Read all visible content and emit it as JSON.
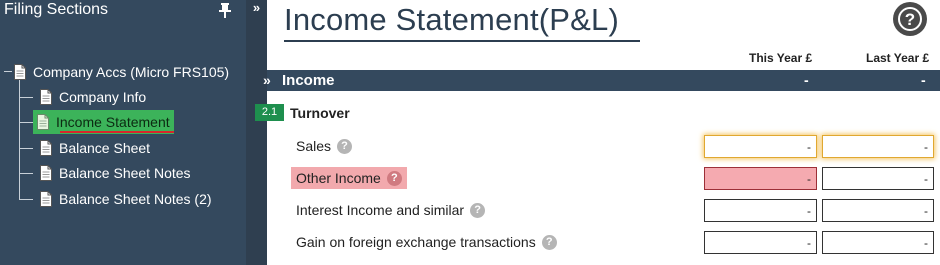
{
  "sidebar": {
    "title": "Filing Sections",
    "root": {
      "label": "Company Accs (Micro FRS105)",
      "icon": "document-icon"
    },
    "items": [
      {
        "label": "Company Info",
        "icon": "document-icon",
        "active": false
      },
      {
        "label": "Income Statement",
        "icon": "document-icon",
        "active": true
      },
      {
        "label": "Balance Sheet",
        "icon": "document-icon",
        "active": false
      },
      {
        "label": "Balance Sheet Notes",
        "icon": "document-icon",
        "active": false
      },
      {
        "label": "Balance Sheet Notes (2)",
        "icon": "document-icon",
        "active": false
      }
    ],
    "collapse_label": "»"
  },
  "page": {
    "title": "Income Statement(P&L)",
    "help_label": "?"
  },
  "columns": {
    "this_year": "This Year £",
    "last_year": "Last Year £"
  },
  "section": {
    "title": "Income",
    "this_year_total": "-",
    "last_year_total": "-"
  },
  "group": {
    "ref": "2.1",
    "label": "Turnover"
  },
  "rows": [
    {
      "label": "Sales",
      "this_year": "-",
      "last_year": "-",
      "state": "focused"
    },
    {
      "label": "Other Income",
      "this_year": "-",
      "last_year": "-",
      "state": "error"
    },
    {
      "label": "Interest Income and similar",
      "this_year": "-",
      "last_year": "-",
      "state": "normal"
    },
    {
      "label": "Gain on foreign exchange transactions",
      "this_year": "-",
      "last_year": "-",
      "state": "normal"
    }
  ],
  "colors": {
    "sidebar_bg": "#34495e",
    "active_item": "#3cb35a",
    "error_bg": "#f5aab0",
    "focus_glow": "#f5c560",
    "badge": "#1e8f4e"
  }
}
